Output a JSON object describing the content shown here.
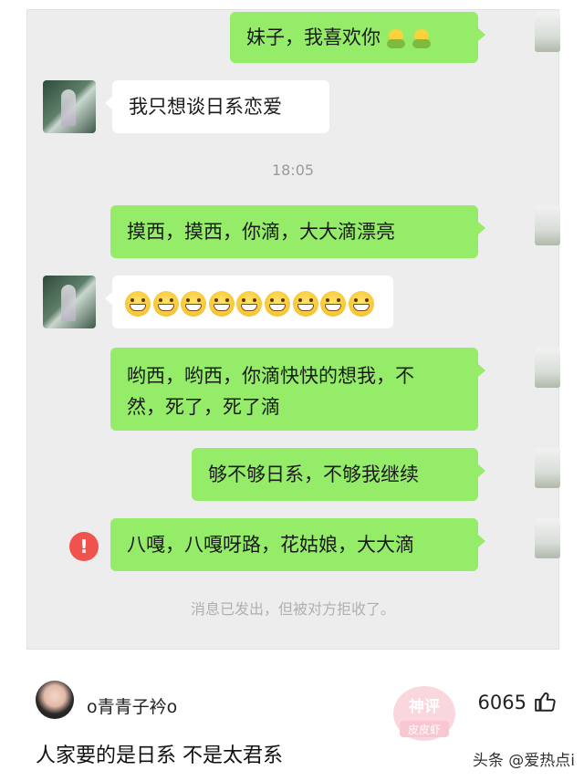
{
  "chat": {
    "messages": [
      {
        "side": "me",
        "text": "妹子，我喜欢你"
      },
      {
        "side": "other",
        "text": "我只想谈日系恋爱"
      },
      {
        "side": "time",
        "text": "18:05"
      },
      {
        "side": "me",
        "text": "摸西，摸西，你滴，大大滴漂亮"
      },
      {
        "side": "other",
        "text": "",
        "emoji": "grin-emoji",
        "emoji_count": 9
      },
      {
        "side": "me",
        "lines": [
          "哟西，哟西，你滴快快的想我，不",
          "然，死了，死了滴"
        ]
      },
      {
        "side": "me",
        "text": "够不够日系，不够我继续"
      },
      {
        "side": "me",
        "text": "八嘎，八嘎呀路，花姑娘，大大滴",
        "status": "failed"
      },
      {
        "side": "notice",
        "text": "消息已发出，但被对方拒收了。"
      }
    ],
    "error_mark": "!",
    "colors": {
      "my_bubble": "#95ec69",
      "other_bubble": "#ffffff",
      "error": "#f0524d",
      "background": "#ededed"
    }
  },
  "comment": {
    "username": "o青青子衿o",
    "likes": "6065",
    "text": "人家要的是日系   不是太君系"
  },
  "watermark": {
    "line1": "神评",
    "line2": "皮皮虾"
  },
  "brand": "头条 @爱热点i"
}
